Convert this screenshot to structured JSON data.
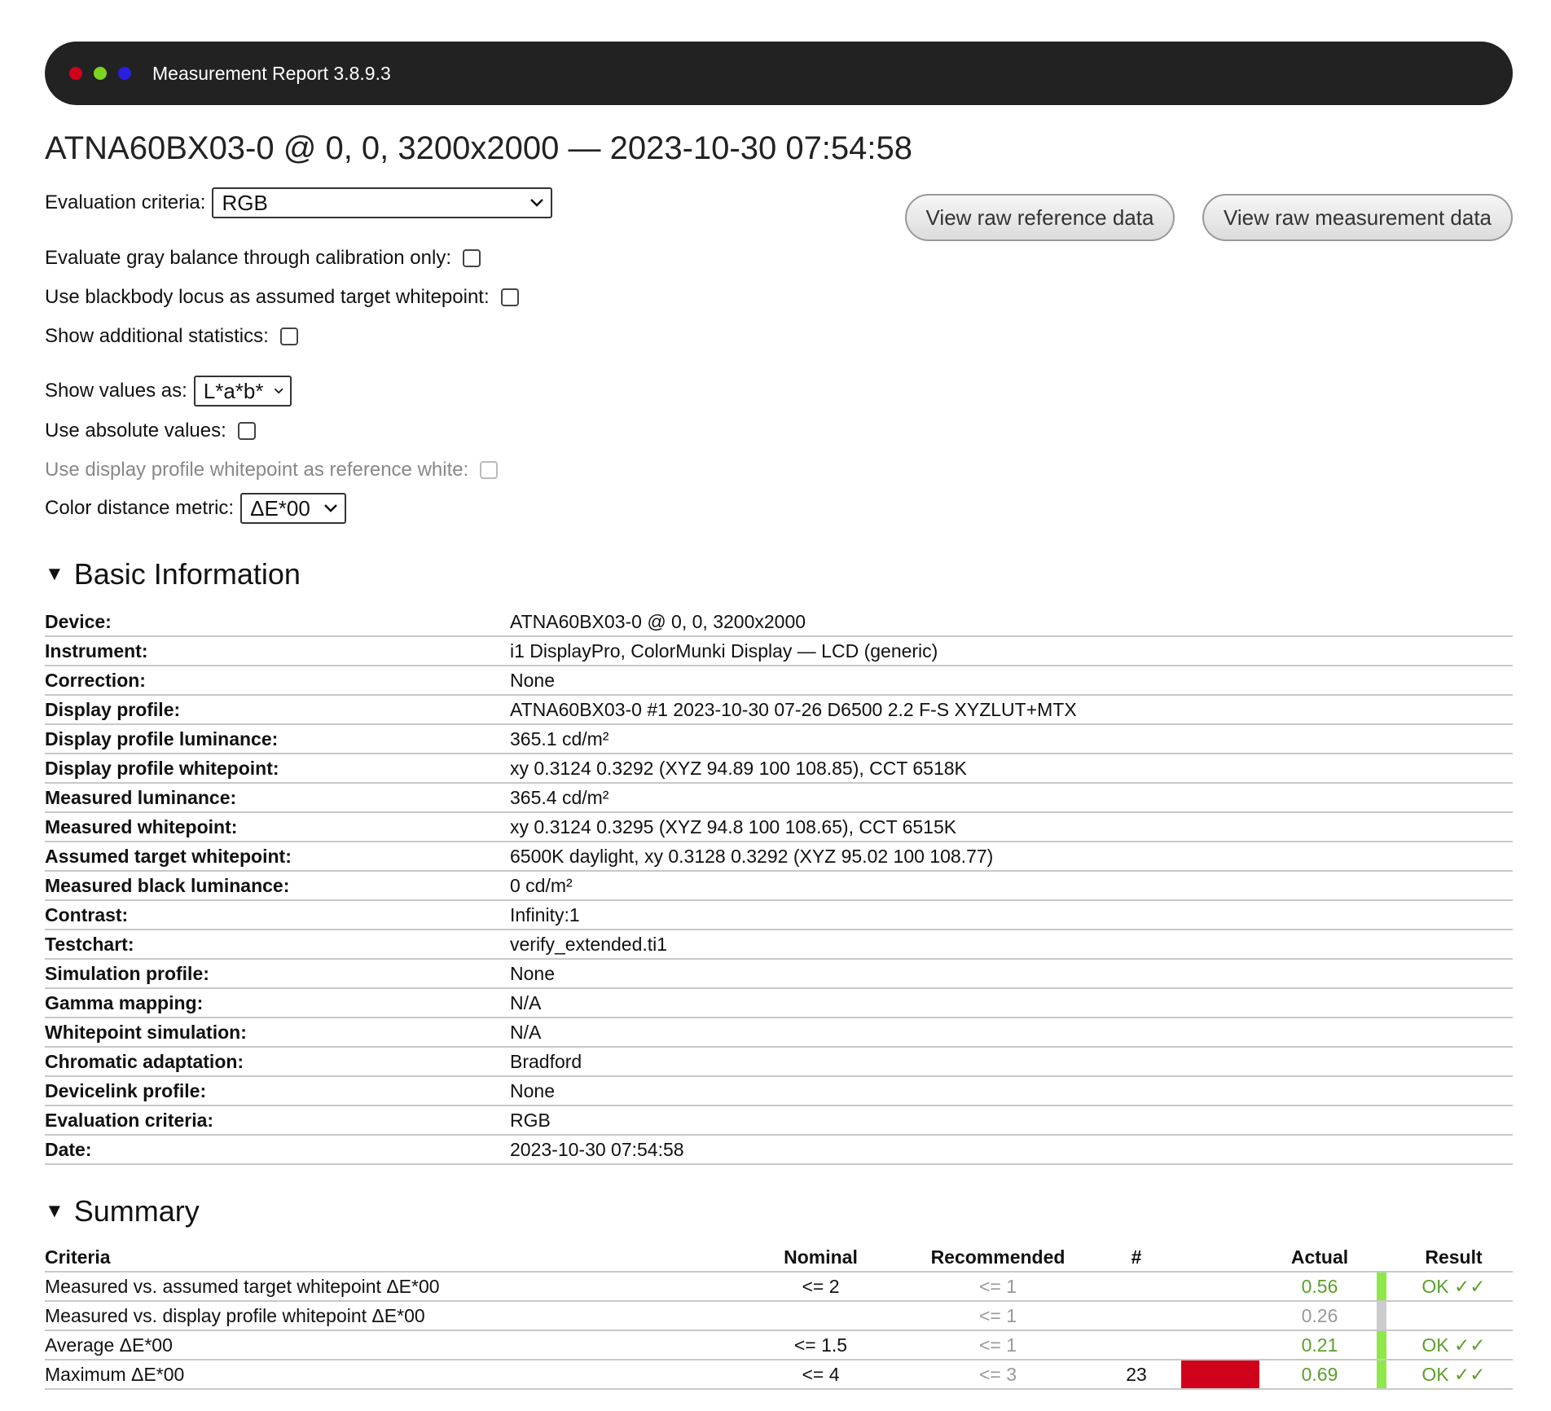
{
  "window": {
    "title": "Measurement Report 3.8.9.3",
    "dots": [
      "#d0021b",
      "#7ed321",
      "#2a1fe0"
    ]
  },
  "page_title": "ATNA60BX03-0 @ 0, 0, 3200x2000 — 2023-10-30 07:54:58",
  "controls": {
    "evaluation_criteria_label": "Evaluation criteria:",
    "evaluation_criteria_value": "RGB",
    "gray_balance_label": "Evaluate gray balance through calibration only:",
    "blackbody_label": "Use blackbody locus as assumed target whitepoint:",
    "additional_stats_label": "Show additional statistics:",
    "show_values_label": "Show values as:",
    "show_values_value": "L*a*b*",
    "absolute_values_label": "Use absolute values:",
    "profile_whitepoint_label": "Use display profile whitepoint as reference white:",
    "color_distance_label": "Color distance metric:",
    "color_distance_value": "ΔE*00"
  },
  "buttons": {
    "raw_reference": "View raw reference data",
    "raw_measurement": "View raw measurement data"
  },
  "basic_info": {
    "title": "Basic Information",
    "rows": [
      {
        "key": "Device:",
        "value": "ATNA60BX03-0 @ 0, 0, 3200x2000"
      },
      {
        "key": "Instrument:",
        "value": "i1 DisplayPro, ColorMunki Display — LCD (generic)"
      },
      {
        "key": "Correction:",
        "value": "None"
      },
      {
        "key": "Display profile:",
        "value": "ATNA60BX03-0 #1 2023-10-30 07-26 D6500 2.2 F-S XYZLUT+MTX"
      },
      {
        "key": "Display profile luminance:",
        "value": "365.1 cd/m²"
      },
      {
        "key": "Display profile whitepoint:",
        "value": "xy 0.3124 0.3292 (XYZ 94.89 100 108.85), CCT 6518K"
      },
      {
        "key": "Measured luminance:",
        "value": "365.4 cd/m²"
      },
      {
        "key": "Measured whitepoint:",
        "value": "xy 0.3124 0.3295 (XYZ 94.8 100 108.65), CCT 6515K"
      },
      {
        "key": "Assumed target whitepoint:",
        "value": "6500K daylight, xy 0.3128 0.3292 (XYZ 95.02 100 108.77)"
      },
      {
        "key": "Measured black luminance:",
        "value": "0 cd/m²"
      },
      {
        "key": "Contrast:",
        "value": "Infinity:1"
      },
      {
        "key": "Testchart:",
        "value": "verify_extended.ti1"
      },
      {
        "key": "Simulation profile:",
        "value": "None"
      },
      {
        "key": "Gamma mapping:",
        "value": "N/A"
      },
      {
        "key": "Whitepoint simulation:",
        "value": "N/A"
      },
      {
        "key": "Chromatic adaptation:",
        "value": "Bradford"
      },
      {
        "key": "Devicelink profile:",
        "value": "None"
      },
      {
        "key": "Evaluation criteria:",
        "value": "RGB"
      },
      {
        "key": "Date:",
        "value": "2023-10-30 07:54:58"
      }
    ]
  },
  "summary": {
    "title": "Summary",
    "headers": {
      "criteria": "Criteria",
      "nominal": "Nominal",
      "recommended": "Recommended",
      "count": "#",
      "actual": "Actual",
      "result": "Result"
    },
    "rows": [
      {
        "criteria": "Measured vs. assumed target whitepoint ΔE*00",
        "nominal": "<= 2",
        "recommended": "<= 1",
        "count": "",
        "bar_color": "",
        "actual": "0.56",
        "actual_color": "#5aa02c",
        "indicator_color": "#8ee84a",
        "result": "OK ✓✓"
      },
      {
        "criteria": "Measured vs. display profile whitepoint ΔE*00",
        "nominal": "",
        "recommended": "<= 1",
        "count": "",
        "bar_color": "",
        "actual": "0.26",
        "actual_color": "#999999",
        "indicator_color": "#cccccc",
        "result": ""
      },
      {
        "criteria": "Average ΔE*00",
        "nominal": "<= 1.5",
        "recommended": "<= 1",
        "count": "",
        "bar_color": "",
        "actual": "0.21",
        "actual_color": "#5aa02c",
        "indicator_color": "#8ee84a",
        "result": "OK ✓✓"
      },
      {
        "criteria": "Maximum ΔE*00",
        "nominal": "<= 4",
        "recommended": "<= 3",
        "count": "23",
        "bar_color": "#d0021b",
        "actual": "0.69",
        "actual_color": "#5aa02c",
        "indicator_color": "#8ee84a",
        "result": "OK ✓✓"
      }
    ]
  }
}
